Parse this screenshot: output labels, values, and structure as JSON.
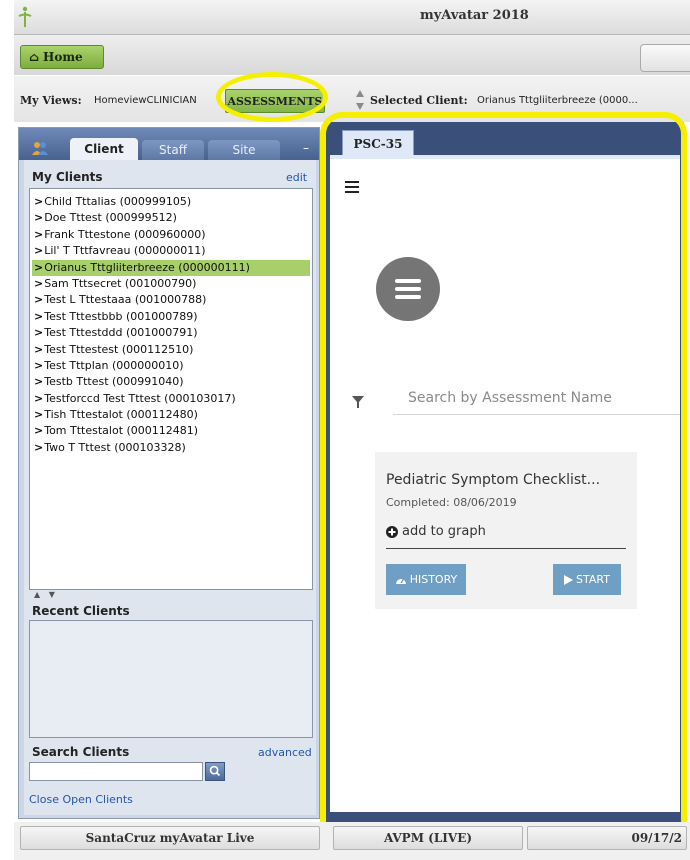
{
  "window": {
    "title": "myAvatar 2018"
  },
  "toolbar": {
    "home_label": "Home"
  },
  "views": {
    "label": "My Views:",
    "value": "HomeviewCLINICIAN",
    "assessments_label": "ASSESSMENTS",
    "selected_label": "Selected Client:",
    "selected_value": "Orianus Tttgliiterbreeze (0000..."
  },
  "left_panel": {
    "tabs": [
      {
        "label": "Client"
      },
      {
        "label": "Staff"
      },
      {
        "label": "Site"
      }
    ],
    "collapse_label": "–",
    "my_clients_heading": "My Clients",
    "edit_label": "edit",
    "clients": [
      "Child Tttalias (000999105)",
      "Doe Tttest (000999512)",
      "Frank Tttestone (000960000)",
      "Lil' T Tttfavreau (000000011)",
      "Orianus Tttgliiterbreeze (000000111)",
      "Sam Tttsecret (001000790)",
      "Test L Tttestaaa (001000788)",
      "Test Tttestbbb (001000789)",
      "Test Tttestddd (001000791)",
      "Test Tttestest (000112510)",
      "Test Tttplan (000000010)",
      "Testb Tttest (000991040)",
      "Testforccd Test Tttest (000103017)",
      "Tish Tttestalot (000112480)",
      "Tom Tttestalot (000112481)",
      "Two T Tttest (000103328)"
    ],
    "selected_client_index": 4,
    "recent_heading": "Recent Clients",
    "search_heading": "Search Clients",
    "advanced_label": "advanced",
    "close_open_label": "Close Open Clients"
  },
  "right_panel": {
    "tab_label": "PSC-35",
    "search_placeholder": "Search by Assessment Name",
    "card": {
      "title": "Pediatric Symptom Checklist...",
      "completed": "Completed: 08/06/2019",
      "add_to_graph": "add to graph",
      "history_label": "HISTORY",
      "start_label": "START"
    }
  },
  "status": {
    "environment": "SantaCruz myAvatar Live",
    "server": "AVPM (LIVE)",
    "date": "09/17/2"
  },
  "colors": {
    "accent_green": "#a8d06a",
    "highlight_yellow": "#f5ef00",
    "panel_blue": "#48628f",
    "button_blue": "#6f9fc4"
  },
  "icons": [
    "app-logo-icon",
    "home-icon",
    "people-icon",
    "hamburger-icon",
    "menu-icon",
    "filter-icon",
    "plus-circle-icon",
    "dashboard-icon",
    "play-icon",
    "search-icon"
  ]
}
